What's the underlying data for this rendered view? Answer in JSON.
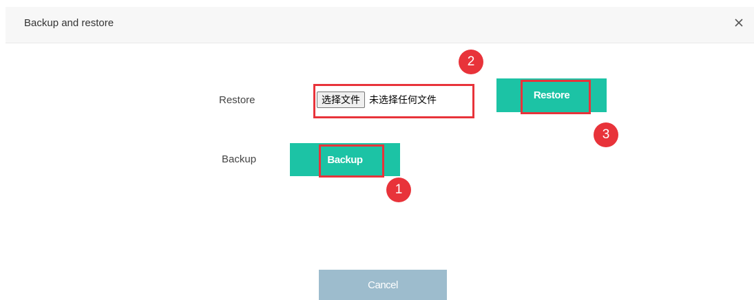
{
  "dialog": {
    "title": "Backup and restore",
    "close_icon": "close-icon"
  },
  "restore": {
    "label": "Restore",
    "choose_file_label": "选择文件",
    "no_file_text": "未选择任何文件",
    "button_label": "Restore"
  },
  "backup": {
    "label": "Backup",
    "button_label": "Backup"
  },
  "footer": {
    "cancel_label": "Cancel"
  },
  "annotations": {
    "step_1": "1",
    "step_2": "2",
    "step_3": "3"
  },
  "colors": {
    "primary": "#1cc3a5",
    "cancel": "#9dbccd",
    "highlight": "#e8333a",
    "header_bg": "#f7f7f7"
  }
}
